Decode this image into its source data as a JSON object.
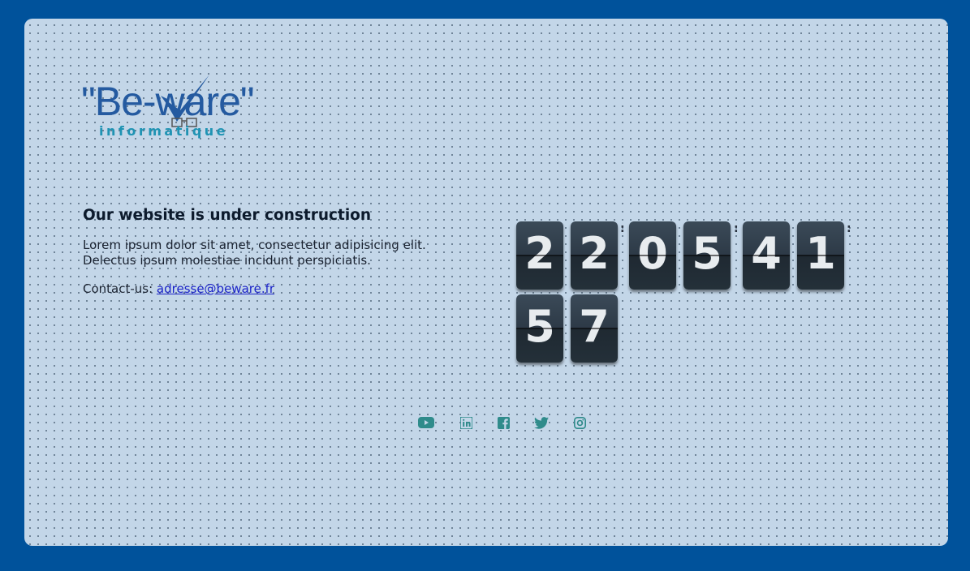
{
  "logo": {
    "main_text": "\"Be-ware\"",
    "sub_text": "informatique"
  },
  "heading": "Our website is under construction",
  "description": "Lorem ipsum dolor sit amet, consectetur adipisicing elit. Delectus ipsum molestiae incidunt perspiciatis.",
  "contact": {
    "label": "Contact-us: ",
    "email": "adresse@beware.fr"
  },
  "countdown": {
    "group1": [
      "2",
      "2"
    ],
    "group2": [
      "0",
      "5"
    ],
    "group3": [
      "4",
      "1"
    ],
    "group4": [
      "5",
      "7"
    ],
    "separator": ":"
  },
  "social": [
    "youtube-icon",
    "linkedin-icon",
    "facebook-icon",
    "twitter-icon",
    "instagram-icon"
  ],
  "colors": {
    "background": "#00529b",
    "card": "#c3d6e8",
    "logo_blue": "#245aa0",
    "logo_teal": "#1f93b3",
    "social_icon": "#2f8b8b",
    "digit_tile": "#2d3a47"
  }
}
